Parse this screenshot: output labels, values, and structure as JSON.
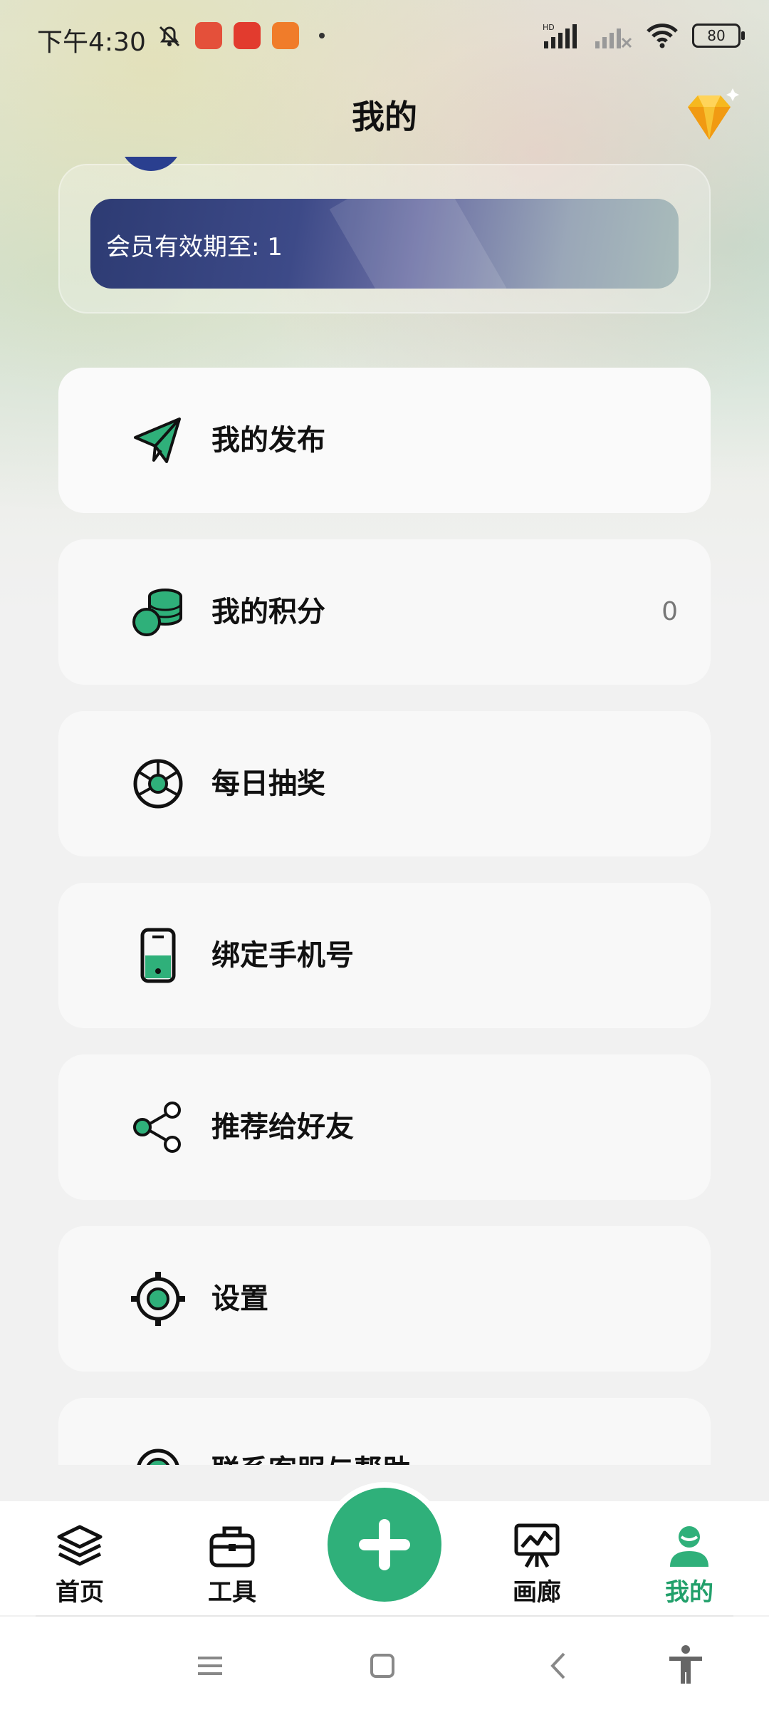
{
  "status_bar": {
    "time": "下午4:30",
    "battery": "80",
    "network": "HD"
  },
  "header": {
    "title": "我的"
  },
  "member": {
    "expiry_text": "会员有效期至: 1"
  },
  "menu": {
    "items": [
      {
        "label": "我的发布",
        "value": "",
        "icon": "paper-plane-icon"
      },
      {
        "label": "我的积分",
        "value": "0",
        "icon": "coins-icon"
      },
      {
        "label": "每日抽奖",
        "value": "",
        "icon": "prize-wheel-icon"
      },
      {
        "label": "绑定手机号",
        "value": "",
        "icon": "phone-icon"
      },
      {
        "label": "推荐给好友",
        "value": "",
        "icon": "share-icon"
      },
      {
        "label": "设置",
        "value": "",
        "icon": "settings-icon"
      },
      {
        "label": "联系客服与帮助",
        "value": "",
        "icon": "support-icon"
      }
    ]
  },
  "tabbar": {
    "items": [
      {
        "label": "首页",
        "icon": "layers-icon"
      },
      {
        "label": "工具",
        "icon": "toolbox-icon"
      },
      {
        "label": "画廊",
        "icon": "gallery-easel-icon"
      },
      {
        "label": "我的",
        "icon": "user-icon"
      }
    ],
    "active": "我的",
    "fab_icon": "plus-icon"
  },
  "colors": {
    "accent": "#2fb07a",
    "active_tab": "#22a06b",
    "banner_start": "#2d3b73",
    "banner_end": "#a9bcbb"
  }
}
